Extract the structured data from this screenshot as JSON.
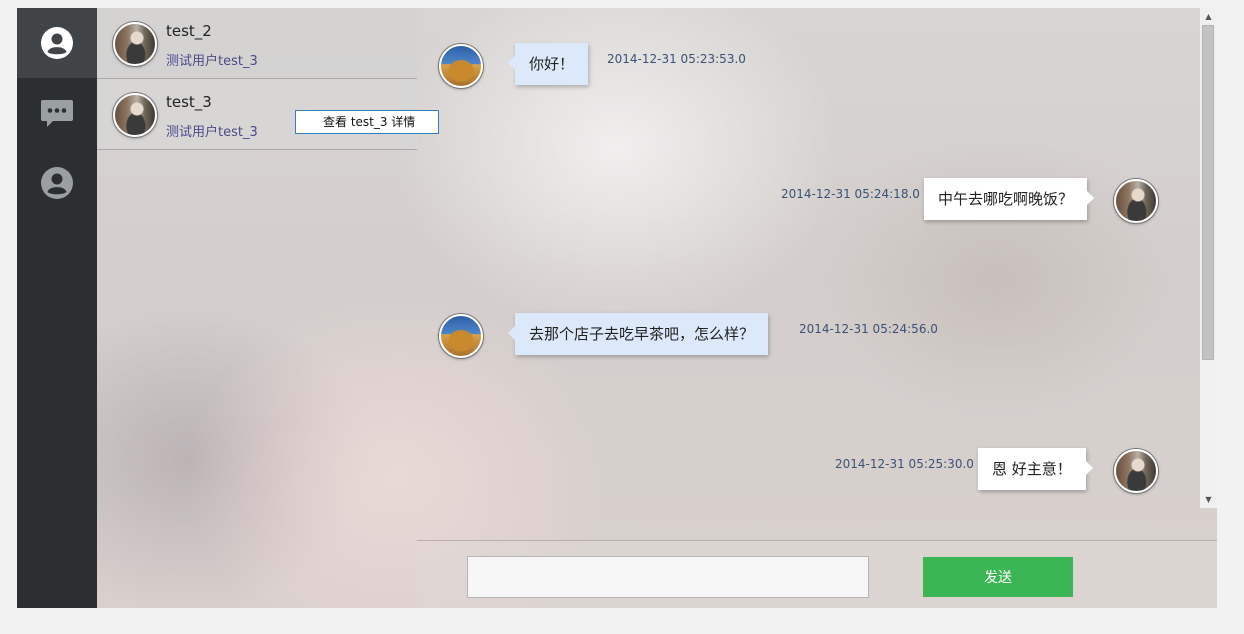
{
  "nav": {
    "items": [
      {
        "icon": "user-icon",
        "active": true
      },
      {
        "icon": "chat-bubble-icon",
        "active": false
      },
      {
        "icon": "user-icon",
        "active": false
      }
    ]
  },
  "contacts": [
    {
      "name": "test_2",
      "subtitle": "测试用户test_3"
    },
    {
      "name": "test_3",
      "subtitle": "测试用户test_3"
    }
  ],
  "tooltip": {
    "text": "查看 test_3 详情"
  },
  "messages": [
    {
      "side": "left",
      "text": "你好！",
      "time": "2014-12-31 05:23:53.0"
    },
    {
      "side": "right",
      "text": "中午去哪吃啊晚饭？",
      "time": "2014-12-31 05:24:18.0"
    },
    {
      "side": "left",
      "text": "去那个店子去吃早茶吧，怎么样？",
      "time": "2014-12-31 05:24:56.0"
    },
    {
      "side": "right",
      "text": "恩  好主意！",
      "time": "2014-12-31 05:25:30.0"
    }
  ],
  "composer": {
    "input_value": "",
    "send_label": "发送"
  },
  "colors": {
    "accent": "#3cb555",
    "nav_bg": "#2c2f31",
    "bubble_left": "#dbe9fb"
  }
}
